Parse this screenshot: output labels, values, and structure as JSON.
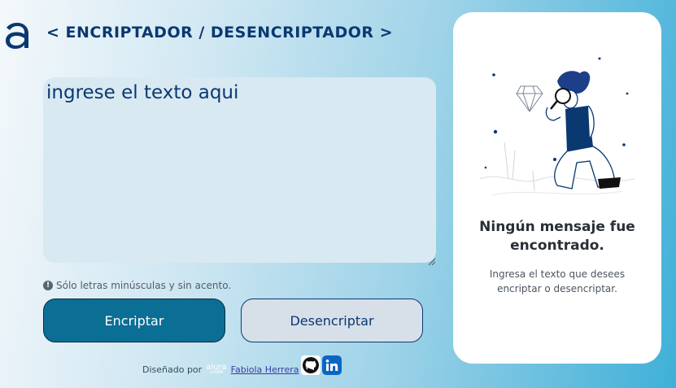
{
  "header": {
    "title": "< ENCRIPTADOR / DESENCRIPTADOR >"
  },
  "input": {
    "placeholder": "ingrese el texto aqui"
  },
  "hint": {
    "text": "Sólo letras minúsculas y sin acento."
  },
  "buttons": {
    "encrypt": "Encriptar",
    "decrypt": "Desencriptar"
  },
  "footer": {
    "prefix": "Diseñado por",
    "brand": "alura",
    "brand_sub": "LATAM",
    "author": "Fabiola Herrera "
  },
  "output_panel": {
    "title": "Ningún mensaje fue encontrado.",
    "description": "Ingresa el texto que desees encriptar o desencriptar."
  },
  "colors": {
    "brand_dark": "#0a3871",
    "encrypt_button": "#0b6e95",
    "decrypt_button": "#d7dfe9",
    "textarea_bg": "#d8e9f2"
  },
  "icons": [
    "alura-logo-icon",
    "info-icon",
    "github-icon",
    "linkedin-icon",
    "resize-grip-icon"
  ]
}
